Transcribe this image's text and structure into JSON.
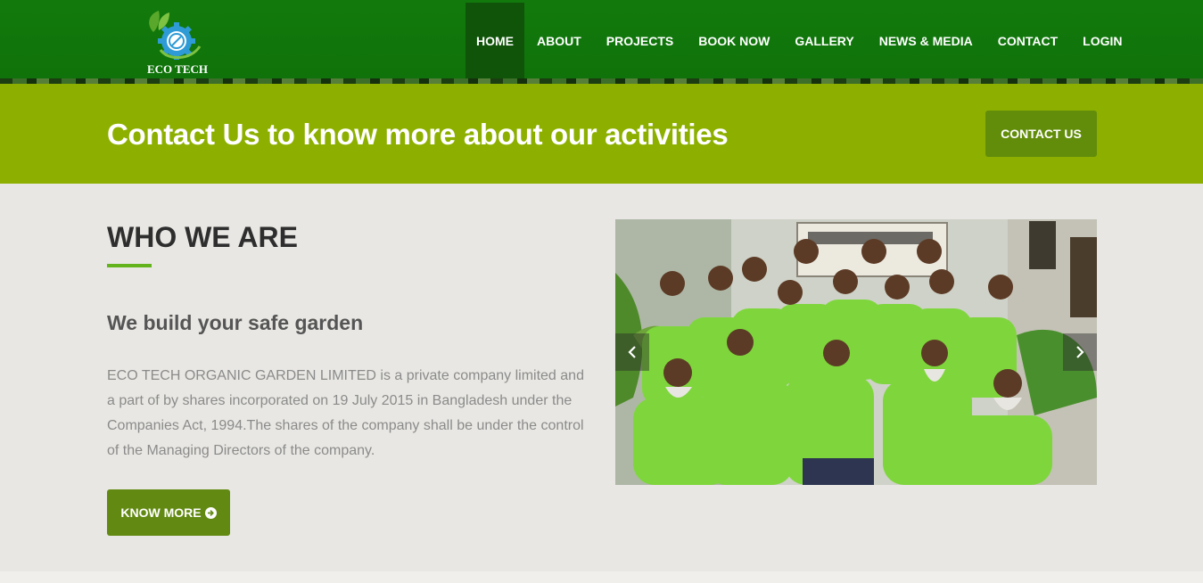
{
  "brand": {
    "name": "ECO TECH"
  },
  "nav": {
    "items": [
      {
        "label": "HOME",
        "active": true
      },
      {
        "label": "ABOUT"
      },
      {
        "label": "PROJECTS"
      },
      {
        "label": "BOOK NOW"
      },
      {
        "label": "GALLERY"
      },
      {
        "label": "NEWS & MEDIA"
      },
      {
        "label": "CONTACT"
      },
      {
        "label": "LOGIN"
      }
    ]
  },
  "banner": {
    "title": "Contact Us to know more about our activities",
    "button_label": "CONTACT US"
  },
  "about": {
    "title": "WHO WE ARE",
    "subtitle": "We build your safe garden",
    "description": "ECO TECH ORGANIC GARDEN LIMITED is a private company limited and a part of by shares incorporated on 19 July 2015 in Bangladesh under the Companies Act, 1994.The shares of the company shall be under the control of the Managing Directors of the company.",
    "button_label": "KNOW MORE",
    "button_icon": "arrow-circle-right-icon"
  },
  "slider": {
    "icons": {
      "prev": "chevron-left-icon",
      "next": "chevron-right-icon"
    }
  },
  "colors": {
    "header": "#127a0c",
    "nav_active": "#0f5409",
    "banner": "#8db000",
    "button": "#628a12",
    "accent_line": "#63b31c",
    "page_bg": "#e8e7e3"
  }
}
